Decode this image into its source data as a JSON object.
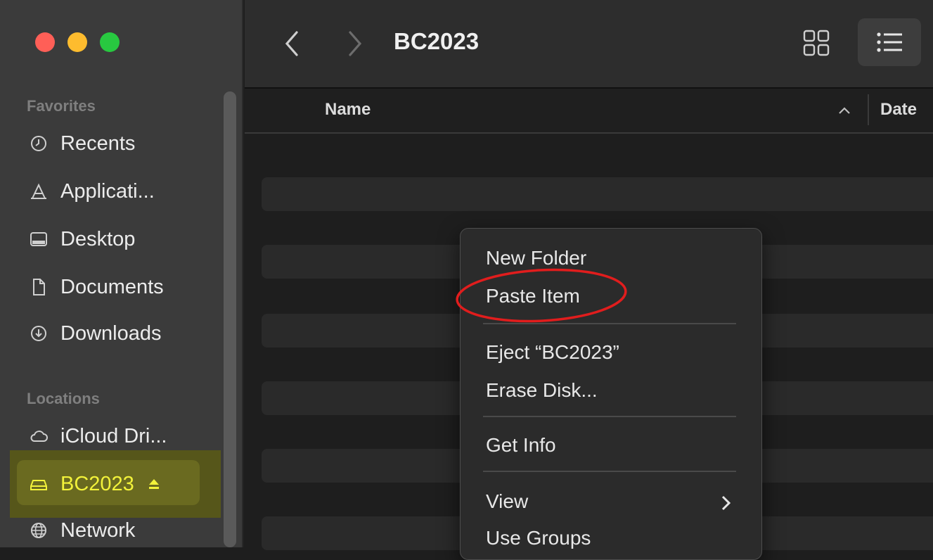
{
  "window": {
    "title": "BC2023"
  },
  "traffic_lights": {
    "close": "#ff5f57",
    "minimize": "#febc2e",
    "zoom": "#28c840"
  },
  "sidebar": {
    "favorites_title": "Favorites",
    "locations_title": "Locations",
    "favorites": [
      {
        "label": "Recents",
        "icon": "clock-icon"
      },
      {
        "label": "Applicati...",
        "icon": "applications-icon"
      },
      {
        "label": "Desktop",
        "icon": "desktop-icon"
      },
      {
        "label": "Documents",
        "icon": "document-icon"
      },
      {
        "label": "Downloads",
        "icon": "download-icon"
      }
    ],
    "locations": [
      {
        "label": "iCloud Dri...",
        "icon": "cloud-icon"
      },
      {
        "label": "BC2023",
        "icon": "drive-icon",
        "eject_icon": "eject-icon",
        "selected": true
      },
      {
        "label": "Network",
        "icon": "globe-icon"
      }
    ]
  },
  "toolbar": {
    "back_icon": "chevron-left-icon",
    "forward_icon": "chevron-right-icon",
    "grid_icon": "grid-view-icon",
    "list_icon": "list-view-icon"
  },
  "columns": {
    "name": "Name",
    "date": "Date",
    "sort_icon": "chevron-up-icon"
  },
  "context_menu": {
    "items": [
      "New Folder",
      "Paste Item",
      "Eject “BC2023”",
      "Erase Disk...",
      "Get Info",
      "View",
      "Use Groups"
    ],
    "submenu_icon": "chevron-right-icon",
    "highlight_color": "#e11d1d"
  },
  "colors": {
    "selection_highlight": "#f2f23a"
  }
}
